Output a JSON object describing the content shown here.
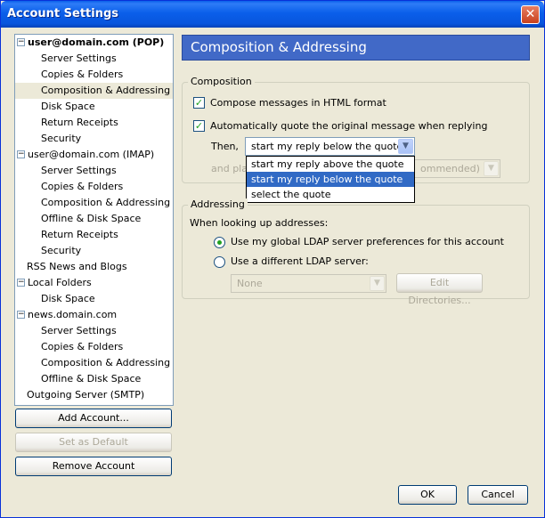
{
  "window": {
    "title": "Account Settings",
    "close_label": "✕"
  },
  "tree": {
    "items": [
      {
        "label": "user@domain.com  (POP)",
        "level": 0,
        "expanded": true,
        "bold": true
      },
      {
        "label": "Server Settings",
        "level": 1
      },
      {
        "label": "Copies & Folders",
        "level": 1
      },
      {
        "label": "Composition & Addressing",
        "level": 1,
        "selected": true
      },
      {
        "label": "Disk Space",
        "level": 1
      },
      {
        "label": "Return Receipts",
        "level": 1
      },
      {
        "label": "Security",
        "level": 1
      },
      {
        "label": "user@domain.com  (IMAP)",
        "level": 0,
        "expanded": true
      },
      {
        "label": "Server Settings",
        "level": 1
      },
      {
        "label": "Copies & Folders",
        "level": 1
      },
      {
        "label": "Composition & Addressing",
        "level": 1
      },
      {
        "label": "Offline & Disk Space",
        "level": 1
      },
      {
        "label": "Return Receipts",
        "level": 1
      },
      {
        "label": "Security",
        "level": 1
      },
      {
        "label": "RSS News and Blogs",
        "level": 0
      },
      {
        "label": "Local Folders",
        "level": 0,
        "expanded": true
      },
      {
        "label": "Disk Space",
        "level": 1
      },
      {
        "label": "news.domain.com",
        "level": 0,
        "expanded": true
      },
      {
        "label": "Server Settings",
        "level": 1
      },
      {
        "label": "Copies & Folders",
        "level": 1
      },
      {
        "label": "Composition & Addressing",
        "level": 1
      },
      {
        "label": "Offline & Disk Space",
        "level": 1
      },
      {
        "label": "Outgoing Server (SMTP)",
        "level": 0
      }
    ]
  },
  "buttons": {
    "add_account": "Add Account...",
    "set_default": "Set as Default",
    "remove_account": "Remove Account",
    "ok": "OK",
    "cancel": "Cancel"
  },
  "panel": {
    "title": "Composition & Addressing",
    "composition": {
      "group_label": "Composition",
      "html_format_label": "Compose messages in HTML format",
      "html_format_checked": true,
      "auto_quote_label": "Automatically quote the original message when replying",
      "auto_quote_checked": true,
      "then_label": "Then,",
      "quote_select_value": "start my reply below the quote",
      "quote_options": [
        "start my reply above the quote",
        "start my reply below the quote",
        "select the quote"
      ],
      "highlighted_option": 1,
      "sig_label_start": "and pla",
      "sig_select_end": "ommended)"
    },
    "addressing": {
      "group_label": "Addressing",
      "lookup_label": "When looking up addresses:",
      "use_global_label": "Use my global LDAP server preferences for this account",
      "use_different_label": "Use a different LDAP server:",
      "ldap_select_value": "None",
      "edit_directories_label": "Edit Directories..."
    }
  }
}
